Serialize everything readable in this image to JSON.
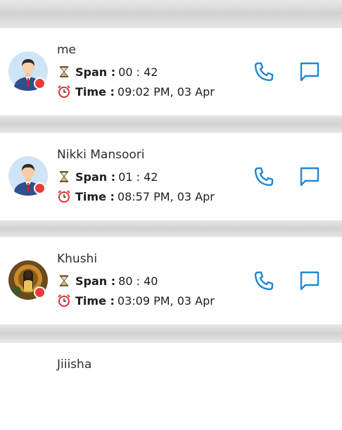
{
  "colors": {
    "accent": "#1e88d6",
    "status_dot": "#e63b3b",
    "card_bg": "#ffffff",
    "divider_bg": "#d6d6d6"
  },
  "labels": {
    "span": "Span :",
    "time": "Time :"
  },
  "entries": [
    {
      "name": "me",
      "span": "00 : 42",
      "time": "09:02 PM, 03 Apr",
      "avatar": "man-avatar-icon"
    },
    {
      "name": "Nikki Mansoori",
      "span": "01 : 42",
      "time": "08:57 PM, 03 Apr",
      "avatar": "man-avatar-icon"
    },
    {
      "name": "Khushi",
      "span": "80 : 40",
      "time": "03:09 PM, 03 Apr",
      "avatar": "photo-avatar"
    },
    {
      "name": "Jiiisha"
    }
  ]
}
